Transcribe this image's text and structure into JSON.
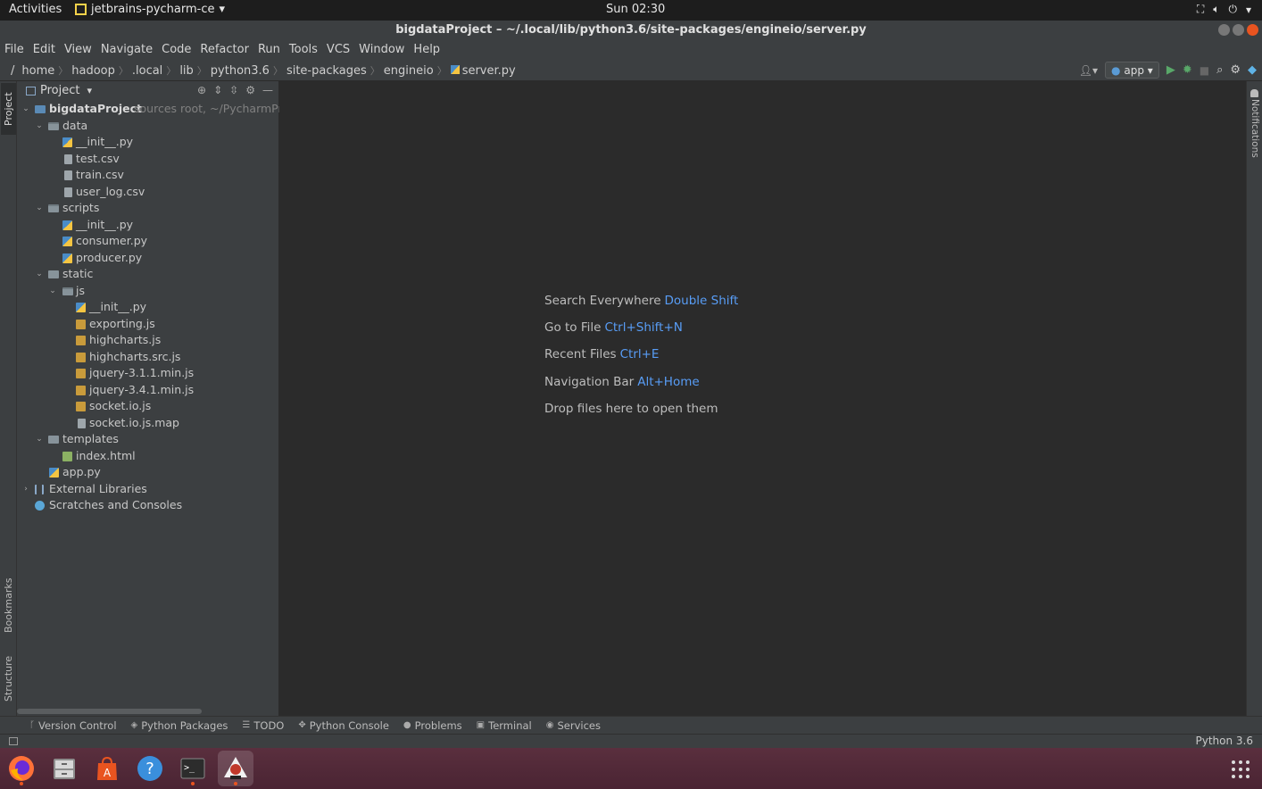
{
  "topbar": {
    "activities": "Activities",
    "app_name": "jetbrains-pycharm-ce",
    "clock": "Sun 02:30"
  },
  "window": {
    "title": "bigdataProject – ~/.local/lib/python3.6/site-packages/engineio/server.py"
  },
  "menu": [
    "File",
    "Edit",
    "View",
    "Navigate",
    "Code",
    "Refactor",
    "Run",
    "Tools",
    "VCS",
    "Window",
    "Help"
  ],
  "breadcrumbs": [
    "/",
    "home",
    "hadoop",
    ".local",
    "lib",
    "python3.6",
    "site-packages",
    "engineio",
    "server.py"
  ],
  "toolbar": {
    "run_config": "app"
  },
  "side_tabs": {
    "project": "Project",
    "bookmarks": "Bookmarks",
    "structure": "Structure",
    "notifications": "Notifications"
  },
  "project_panel": {
    "title": "Project",
    "root_name": "bigdataProject",
    "root_hint": "sources root, ~/PycharmPro",
    "items": [
      {
        "label": "data"
      },
      {
        "label": "__init__.py"
      },
      {
        "label": "test.csv"
      },
      {
        "label": "train.csv"
      },
      {
        "label": "user_log.csv"
      },
      {
        "label": "scripts"
      },
      {
        "label": "__init__.py"
      },
      {
        "label": "consumer.py"
      },
      {
        "label": "producer.py"
      },
      {
        "label": "static"
      },
      {
        "label": "js"
      },
      {
        "label": "__init__.py"
      },
      {
        "label": "exporting.js"
      },
      {
        "label": "highcharts.js"
      },
      {
        "label": "highcharts.src.js"
      },
      {
        "label": "jquery-3.1.1.min.js"
      },
      {
        "label": "jquery-3.4.1.min.js"
      },
      {
        "label": "socket.io.js"
      },
      {
        "label": "socket.io.js.map"
      },
      {
        "label": "templates"
      },
      {
        "label": "index.html"
      },
      {
        "label": "app.py"
      },
      {
        "label": "External Libraries"
      },
      {
        "label": "Scratches and Consoles"
      }
    ]
  },
  "editor_hints": [
    {
      "text": "Search Everywhere",
      "key": "Double Shift"
    },
    {
      "text": "Go to File",
      "key": "Ctrl+Shift+N"
    },
    {
      "text": "Recent Files",
      "key": "Ctrl+E"
    },
    {
      "text": "Navigation Bar",
      "key": "Alt+Home"
    },
    {
      "text": "Drop files here to open them",
      "key": ""
    }
  ],
  "bottom_tools": [
    "Version Control",
    "Python Packages",
    "TODO",
    "Python Console",
    "Problems",
    "Terminal",
    "Services"
  ],
  "status": {
    "interpreter": "Python 3.6"
  },
  "colors": {
    "accent_link": "#589df6",
    "ubuntu_orange": "#e95420"
  }
}
